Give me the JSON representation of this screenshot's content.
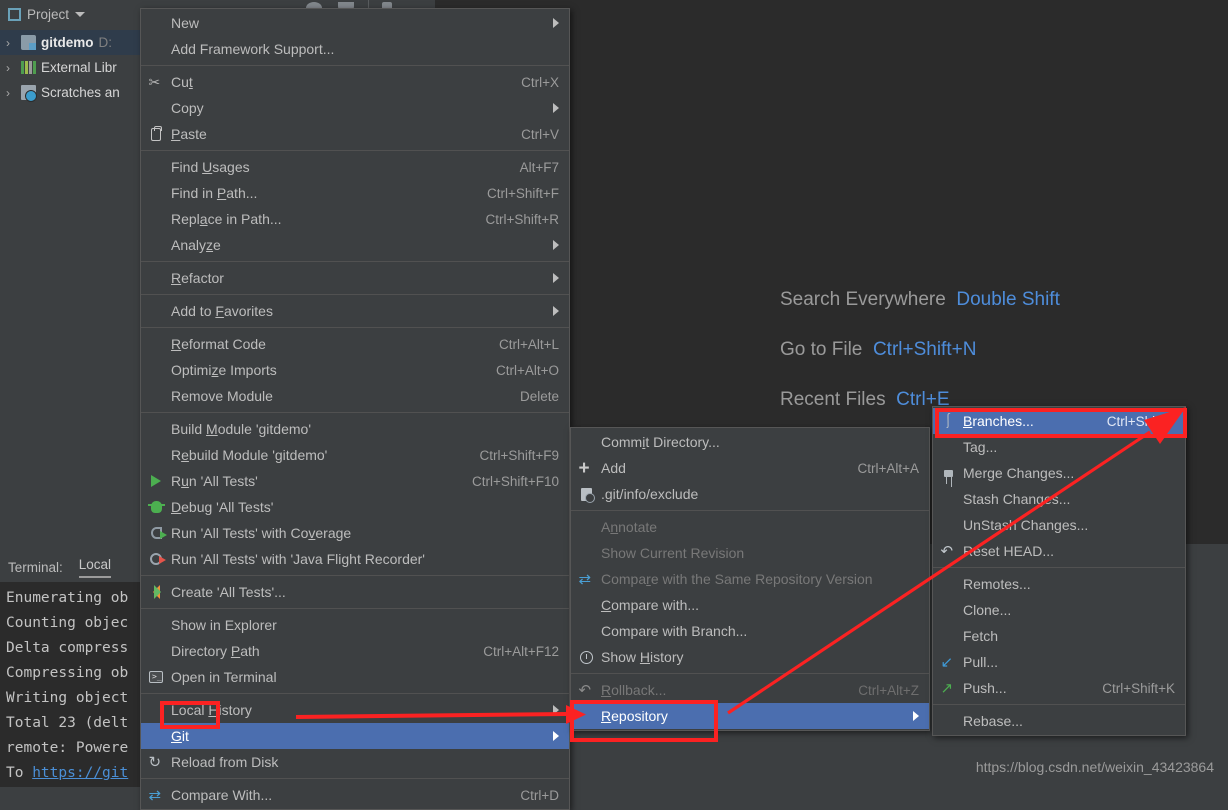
{
  "app": {
    "project_panel_title": "Project",
    "watermark": "https://blog.csdn.net/weixin_43423864"
  },
  "project_tree": {
    "items": [
      {
        "label": "gitdemo",
        "sublabel": "D:",
        "icon": "folder-icon",
        "selected": true
      },
      {
        "label": "External Libr",
        "sublabel": "",
        "icon": "library-icon",
        "selected": false
      },
      {
        "label": "Scratches an",
        "sublabel": "",
        "icon": "scratches-icon",
        "selected": false
      }
    ]
  },
  "terminal": {
    "label": "Terminal:",
    "tab": "Local",
    "lines": [
      "Enumerating ob",
      "Counting objec",
      "Delta compress",
      "Compressing ob",
      "Writing object",
      "Total 23 (delt",
      "remote: Powere",
      "To https://git"
    ]
  },
  "editor_hints": [
    {
      "name": "Search Everywhere",
      "key": "Double Shift"
    },
    {
      "name": "Go to File",
      "key": "Ctrl+Shift+N"
    },
    {
      "name": "Recent Files",
      "key": "Ctrl+E"
    }
  ],
  "context_menu": {
    "name": "project-context-menu",
    "items": [
      {
        "label": "New",
        "key": "",
        "icon": "",
        "submenu": true,
        "state": "normal"
      },
      {
        "label": "Add Framework Support...",
        "key": "",
        "icon": "",
        "submenu": false,
        "state": "normal"
      },
      {
        "separator": true
      },
      {
        "label": "Cut",
        "key": "Ctrl+X",
        "icon": "scissors-icon",
        "submenu": false,
        "state": "normal",
        "mnemonic": "t"
      },
      {
        "label": "Copy",
        "key": "",
        "icon": "",
        "submenu": true,
        "state": "normal"
      },
      {
        "label": "Paste",
        "key": "Ctrl+V",
        "icon": "clipboard-icon",
        "submenu": false,
        "state": "normal",
        "mnemonic": "P"
      },
      {
        "separator": true
      },
      {
        "label": "Find Usages",
        "key": "Alt+F7",
        "icon": "",
        "submenu": false,
        "state": "normal",
        "mnemonic": "U"
      },
      {
        "label": "Find in Path...",
        "key": "Ctrl+Shift+F",
        "icon": "",
        "submenu": false,
        "state": "normal",
        "mnemonic": "P"
      },
      {
        "label": "Replace in Path...",
        "key": "Ctrl+Shift+R",
        "icon": "",
        "submenu": false,
        "state": "normal",
        "mnemonic": "a"
      },
      {
        "label": "Analyze",
        "key": "",
        "icon": "",
        "submenu": true,
        "state": "normal",
        "mnemonic": "z"
      },
      {
        "separator": true
      },
      {
        "label": "Refactor",
        "key": "",
        "icon": "",
        "submenu": true,
        "state": "normal",
        "mnemonic": "R"
      },
      {
        "separator": true
      },
      {
        "label": "Add to Favorites",
        "key": "",
        "icon": "",
        "submenu": true,
        "state": "normal",
        "mnemonic": "F"
      },
      {
        "separator": true
      },
      {
        "label": "Reformat Code",
        "key": "Ctrl+Alt+L",
        "icon": "",
        "submenu": false,
        "state": "normal",
        "mnemonic": "R"
      },
      {
        "label": "Optimize Imports",
        "key": "Ctrl+Alt+O",
        "icon": "",
        "submenu": false,
        "state": "normal",
        "mnemonic": "z"
      },
      {
        "label": "Remove Module",
        "key": "Delete",
        "icon": "",
        "submenu": false,
        "state": "normal"
      },
      {
        "separator": true
      },
      {
        "label": "Build Module 'gitdemo'",
        "key": "",
        "icon": "",
        "submenu": false,
        "state": "normal",
        "mnemonic": "M"
      },
      {
        "label": "Rebuild Module 'gitdemo'",
        "key": "Ctrl+Shift+F9",
        "icon": "",
        "submenu": false,
        "state": "normal",
        "mnemonic": "e"
      },
      {
        "label": "Run 'All Tests'",
        "key": "Ctrl+Shift+F10",
        "icon": "run-icon",
        "submenu": false,
        "state": "normal",
        "mnemonic": "u"
      },
      {
        "label": "Debug 'All Tests'",
        "key": "",
        "icon": "debug-icon",
        "submenu": false,
        "state": "normal",
        "mnemonic": "D"
      },
      {
        "label": "Run 'All Tests' with Coverage",
        "key": "",
        "icon": "coverage-icon",
        "submenu": false,
        "state": "normal",
        "mnemonic": "v"
      },
      {
        "label": "Run 'All Tests' with 'Java Flight Recorder'",
        "key": "",
        "icon": "jfr-icon",
        "submenu": false,
        "state": "normal"
      },
      {
        "separator": true
      },
      {
        "label": "Create 'All Tests'...",
        "key": "",
        "icon": "create-config-icon",
        "submenu": false,
        "state": "normal"
      },
      {
        "separator": true
      },
      {
        "label": "Show in Explorer",
        "key": "",
        "icon": "",
        "submenu": false,
        "state": "normal"
      },
      {
        "label": "Directory Path",
        "key": "Ctrl+Alt+F12",
        "icon": "",
        "submenu": false,
        "state": "normal",
        "mnemonic": "P"
      },
      {
        "label": "Open in Terminal",
        "key": "",
        "icon": "terminal-icon",
        "submenu": false,
        "state": "normal"
      },
      {
        "separator": true
      },
      {
        "label": "Local History",
        "key": "",
        "icon": "",
        "submenu": true,
        "state": "normal",
        "mnemonic": "H"
      },
      {
        "label": "Git",
        "key": "",
        "icon": "",
        "submenu": true,
        "state": "selected",
        "mnemonic": "G"
      },
      {
        "label": "Reload from Disk",
        "key": "",
        "icon": "reload-icon",
        "submenu": false,
        "state": "normal"
      },
      {
        "separator": true
      },
      {
        "label": "Compare With...",
        "key": "Ctrl+D",
        "icon": "compare-icon",
        "submenu": false,
        "state": "normal"
      }
    ]
  },
  "git_submenu": {
    "name": "git-submenu",
    "items": [
      {
        "label": "Commit Directory...",
        "key": "",
        "icon": "",
        "submenu": false,
        "state": "normal",
        "mnemonic": "i"
      },
      {
        "label": "Add",
        "key": "Ctrl+Alt+A",
        "icon": "plus-icon",
        "submenu": false,
        "state": "normal"
      },
      {
        "label": ".git/info/exclude",
        "key": "",
        "icon": "exclude-icon",
        "submenu": false,
        "state": "normal"
      },
      {
        "separator": true
      },
      {
        "label": "Annotate",
        "key": "",
        "icon": "",
        "submenu": false,
        "state": "disabled",
        "mnemonic": "n"
      },
      {
        "label": "Show Current Revision",
        "key": "",
        "icon": "",
        "submenu": false,
        "state": "disabled"
      },
      {
        "label": "Compare with the Same Repository Version",
        "key": "",
        "icon": "compare-icon",
        "submenu": false,
        "state": "disabled",
        "mnemonic": "r"
      },
      {
        "label": "Compare with...",
        "key": "",
        "icon": "",
        "submenu": false,
        "state": "normal",
        "mnemonic": "C"
      },
      {
        "label": "Compare with Branch...",
        "key": "",
        "icon": "",
        "submenu": false,
        "state": "normal"
      },
      {
        "label": "Show History",
        "key": "",
        "icon": "history-icon",
        "submenu": false,
        "state": "normal",
        "mnemonic": "H"
      },
      {
        "separator": true
      },
      {
        "label": "Rollback...",
        "key": "Ctrl+Alt+Z",
        "icon": "rollback-icon",
        "submenu": false,
        "state": "disabled",
        "mnemonic": "R"
      },
      {
        "label": "Repository",
        "key": "",
        "icon": "",
        "submenu": true,
        "state": "selected",
        "mnemonic": "R"
      }
    ]
  },
  "repository_submenu": {
    "name": "repository-submenu",
    "items": [
      {
        "label": "Branches...",
        "key": "Ctrl+Shift+`",
        "icon": "branch-icon",
        "submenu": false,
        "state": "selected",
        "mnemonic": "B"
      },
      {
        "label": "Tag...",
        "key": "",
        "icon": "",
        "submenu": false,
        "state": "normal"
      },
      {
        "label": "Merge Changes...",
        "key": "",
        "icon": "merge-icon",
        "submenu": false,
        "state": "normal"
      },
      {
        "label": "Stash Changes...",
        "key": "",
        "icon": "",
        "submenu": false,
        "state": "normal"
      },
      {
        "label": "UnStash Changes...",
        "key": "",
        "icon": "",
        "submenu": false,
        "state": "normal"
      },
      {
        "label": "Reset HEAD...",
        "key": "",
        "icon": "reset-icon",
        "submenu": false,
        "state": "normal"
      },
      {
        "separator": true
      },
      {
        "label": "Remotes...",
        "key": "",
        "icon": "",
        "submenu": false,
        "state": "normal"
      },
      {
        "label": "Clone...",
        "key": "",
        "icon": "",
        "submenu": false,
        "state": "normal"
      },
      {
        "label": "Fetch",
        "key": "",
        "icon": "",
        "submenu": false,
        "state": "normal"
      },
      {
        "label": "Pull...",
        "key": "",
        "icon": "pull-icon",
        "submenu": false,
        "state": "normal"
      },
      {
        "label": "Push...",
        "key": "Ctrl+Shift+K",
        "icon": "push-icon",
        "submenu": false,
        "state": "normal"
      },
      {
        "separator": true
      },
      {
        "label": "Rebase...",
        "key": "",
        "icon": "",
        "submenu": false,
        "state": "normal"
      }
    ]
  },
  "annotations": {
    "highlight_color": "#fb2222",
    "boxes": [
      "git-menu-item",
      "repository-menu-item",
      "branches-menu-item"
    ],
    "arrows": [
      "git-to-repository-arrow",
      "repository-to-branches-arrow"
    ]
  },
  "colors": {
    "selection_blue": "#4b6eaf",
    "menu_bg": "#3c3f41",
    "editor_bg": "#2b2b2b",
    "hint_key_blue": "#4e8ddb",
    "annotation_red": "#fb2222"
  }
}
